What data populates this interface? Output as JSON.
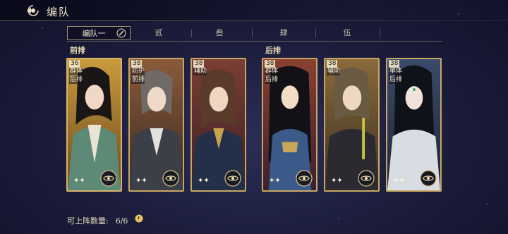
{
  "header": {
    "title": "编队"
  },
  "tabs": [
    {
      "label": "编队一",
      "active": true
    },
    {
      "label": "贰",
      "active": false
    },
    {
      "label": "叁",
      "active": false
    },
    {
      "label": "肆",
      "active": false
    },
    {
      "label": "伍",
      "active": false
    }
  ],
  "rows": {
    "front": "前排",
    "back": "后排"
  },
  "cards": [
    {
      "level": "36",
      "tags": [
        "群体",
        "后排"
      ],
      "frame": "gold"
    },
    {
      "level": "38",
      "tags": [
        "防护",
        "前排"
      ],
      "frame": "orange"
    },
    {
      "level": "38",
      "tags": [
        "辅助"
      ],
      "frame": "orange"
    },
    {
      "level": "38",
      "tags": [
        "群体",
        "后排"
      ],
      "frame": "orange"
    },
    {
      "level": "38",
      "tags": [
        "辅助"
      ],
      "frame": "orange"
    },
    {
      "level": "38",
      "tags": [
        "单体",
        "后排"
      ],
      "frame": "orange"
    }
  ],
  "footer": {
    "label": "可上阵数量:",
    "count": "6/6"
  },
  "colors": {
    "gold": "#d8b36a",
    "accent": "#c8a764",
    "bg": "#1b1c3a"
  }
}
